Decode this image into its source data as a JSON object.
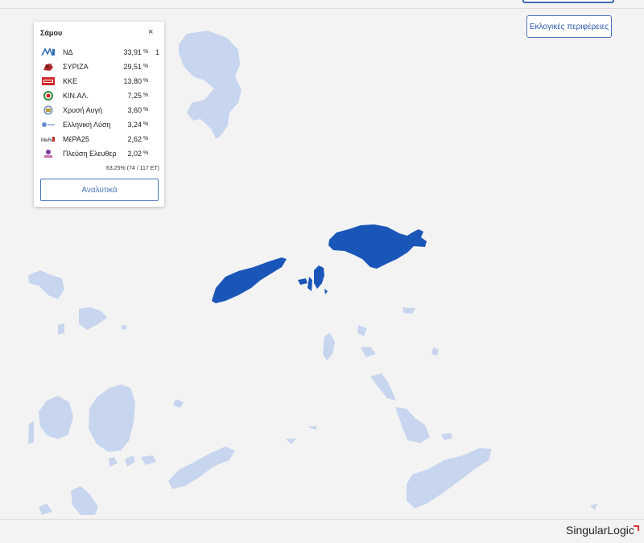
{
  "header": {
    "regions_button": "Εκλογικές περιφέρειες"
  },
  "popup": {
    "title": "Σάμου",
    "close_symbol": "×",
    "unit": "%",
    "parties": [
      {
        "name": "ΝΔ",
        "pct": "33,91",
        "seats": "1",
        "logo": "nd-logo",
        "color": "#2f6db5"
      },
      {
        "name": "ΣΥΡΙΖΑ",
        "pct": "29,51",
        "seats": "",
        "logo": "syriza-logo",
        "color": "#b0282d"
      },
      {
        "name": "ΚΚΕ",
        "pct": "13,80",
        "seats": "",
        "logo": "kke-logo",
        "color": "#d1242a"
      },
      {
        "name": "ΚΙΝ.ΑΛ.",
        "pct": "7,25",
        "seats": "",
        "logo": "kinal-logo",
        "color": "#2f8c3c"
      },
      {
        "name": "Χρυσή Αυγή",
        "pct": "3,60",
        "seats": "",
        "logo": "xa-logo",
        "color": "#4a6fb0"
      },
      {
        "name": "Ελληνική Λύση",
        "pct": "3,24",
        "seats": "",
        "logo": "el-logo",
        "color": "#6a8fc9"
      },
      {
        "name": "ΜέΡΑ25",
        "pct": "2,62",
        "seats": "",
        "logo": "mera25-logo",
        "color": "#c03030"
      },
      {
        "name": "Πλεύση Ελευθερίας",
        "pct": "2,02",
        "seats": "",
        "logo": "plefsi-logo",
        "color": "#7a3a9a"
      }
    ],
    "turnout_pct": "63,25",
    "turnout_unit": "%",
    "counted": "(74 / 117 ΕΤ)",
    "details_button": "Αναλυτικά"
  },
  "map": {
    "highlight_color": "#1a56b8",
    "other_islands_color": "#c7d6ee",
    "sea_color": "#f3f3f4"
  },
  "brand": {
    "text": "SingularLogic",
    "accent_color": "#d33333"
  }
}
